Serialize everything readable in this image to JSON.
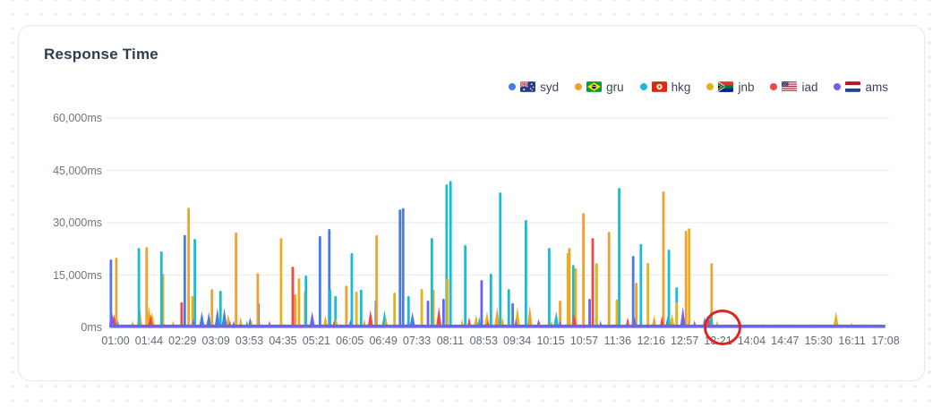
{
  "card": {
    "title": "Response Time"
  },
  "legend": {
    "items": [
      {
        "label": "syd",
        "flag": "australia",
        "color": "#4a7ae6"
      },
      {
        "label": "gru",
        "flag": "brazil",
        "color": "#f0a12f"
      },
      {
        "label": "hkg",
        "flag": "hongkong",
        "color": "#19bcd6"
      },
      {
        "label": "jnb",
        "flag": "southafrica",
        "color": "#e8b019"
      },
      {
        "label": "iad",
        "flag": "usa",
        "color": "#ef4646"
      },
      {
        "label": "ams",
        "flag": "netherlands",
        "color": "#6b64f3"
      }
    ]
  },
  "chart_data": {
    "type": "area",
    "title": "Response Time",
    "unit": "ms",
    "ylim": [
      0,
      60000
    ],
    "grid": true,
    "legend_position": "top-right",
    "y_ticks": [
      "60,000ms",
      "45,000ms",
      "30,000ms",
      "15,000ms",
      "0ms"
    ],
    "y_tick_values": [
      60000,
      45000,
      30000,
      15000,
      0
    ],
    "x_ticks": [
      "01:00",
      "01:44",
      "02:29",
      "03:09",
      "03:53",
      "04:35",
      "05:21",
      "06:05",
      "06:49",
      "07:33",
      "08:11",
      "08:53",
      "09:34",
      "10:15",
      "10:57",
      "11:36",
      "12:16",
      "12:57",
      "13:21",
      "14:04",
      "14:47",
      "15:30",
      "16:11",
      "17:08"
    ],
    "baseline_ms": 800,
    "series": [
      {
        "name": "syd",
        "flag": "australia",
        "color": "#4a7ae6",
        "spikes": [
          [
            0.001,
            19500
          ],
          [
            0.067,
            2500
          ],
          [
            0.096,
            26500
          ],
          [
            0.118,
            4600
          ],
          [
            0.127,
            4400
          ],
          [
            0.138,
            5600
          ],
          [
            0.147,
            5600
          ],
          [
            0.18,
            3000
          ],
          [
            0.191,
            6900
          ],
          [
            0.27,
            26200
          ],
          [
            0.282,
            28200
          ],
          [
            0.342,
            7700
          ],
          [
            0.373,
            33800
          ],
          [
            0.377,
            34200
          ],
          [
            0.389,
            4500
          ],
          [
            0.401,
            2200
          ],
          [
            0.518,
            7000
          ],
          [
            0.551,
            2500
          ],
          [
            0.631,
            2000
          ],
          [
            0.673,
            20500
          ],
          [
            0.718,
            4000
          ],
          [
            0.765,
            3000
          ]
        ]
      },
      {
        "name": "gru",
        "flag": "brazil",
        "color": "#f0a12f",
        "spikes": [
          [
            0.008,
            20000
          ],
          [
            0.038,
            6400
          ],
          [
            0.047,
            23000
          ],
          [
            0.068,
            15400
          ],
          [
            0.101,
            34300
          ],
          [
            0.131,
            11000
          ],
          [
            0.162,
            27200
          ],
          [
            0.19,
            15500
          ],
          [
            0.238,
            9500
          ],
          [
            0.251,
            10300
          ],
          [
            0.304,
            12000
          ],
          [
            0.327,
            2500
          ],
          [
            0.343,
            26400
          ],
          [
            0.384,
            3200
          ],
          [
            0.416,
            10800
          ],
          [
            0.471,
            3600
          ],
          [
            0.498,
            5900
          ],
          [
            0.54,
            6400
          ],
          [
            0.579,
            7700
          ],
          [
            0.591,
            22800
          ],
          [
            0.609,
            32800
          ],
          [
            0.642,
            27400
          ],
          [
            0.677,
            12800
          ],
          [
            0.7,
            3500
          ],
          [
            0.712,
            39000
          ],
          [
            0.741,
            27700
          ],
          [
            0.774,
            18400
          ],
          [
            0.839,
            1100
          ],
          [
            0.902,
            1000
          ],
          [
            0.954,
            1400
          ],
          [
            0.983,
            900
          ]
        ]
      },
      {
        "name": "hkg",
        "flag": "hongkong",
        "color": "#19bcd6",
        "spikes": [
          [
            0.01,
            2000
          ],
          [
            0.037,
            22800
          ],
          [
            0.066,
            21800
          ],
          [
            0.109,
            25400
          ],
          [
            0.142,
            10500
          ],
          [
            0.176,
            2000
          ],
          [
            0.252,
            14900
          ],
          [
            0.283,
            11000
          ],
          [
            0.29,
            9000
          ],
          [
            0.311,
            21300
          ],
          [
            0.323,
            10800
          ],
          [
            0.353,
            5000
          ],
          [
            0.384,
            9000
          ],
          [
            0.414,
            25600
          ],
          [
            0.433,
            41000
          ],
          [
            0.438,
            42000
          ],
          [
            0.457,
            23600
          ],
          [
            0.475,
            3000
          ],
          [
            0.49,
            15400
          ],
          [
            0.502,
            38700
          ],
          [
            0.513,
            11000
          ],
          [
            0.535,
            30800
          ],
          [
            0.565,
            22800
          ],
          [
            0.574,
            4600
          ],
          [
            0.596,
            17900
          ],
          [
            0.655,
            40000
          ],
          [
            0.683,
            23900
          ],
          [
            0.719,
            22300
          ],
          [
            0.729,
            11500
          ],
          [
            0.773,
            5000
          ]
        ]
      },
      {
        "name": "jnb",
        "flag": "southafrica",
        "color": "#e8b019",
        "spikes": [
          [
            0.029,
            2000
          ],
          [
            0.05,
            6200
          ],
          [
            0.054,
            4400
          ],
          [
            0.081,
            2000
          ],
          [
            0.106,
            9000
          ],
          [
            0.152,
            3800
          ],
          [
            0.168,
            3000
          ],
          [
            0.182,
            2300
          ],
          [
            0.205,
            2000
          ],
          [
            0.22,
            25600
          ],
          [
            0.243,
            14100
          ],
          [
            0.277,
            3500
          ],
          [
            0.291,
            2800
          ],
          [
            0.317,
            10300
          ],
          [
            0.355,
            3000
          ],
          [
            0.366,
            10000
          ],
          [
            0.401,
            11000
          ],
          [
            0.434,
            14000
          ],
          [
            0.453,
            2500
          ],
          [
            0.485,
            4600
          ],
          [
            0.505,
            3000
          ],
          [
            0.524,
            5900
          ],
          [
            0.568,
            2000
          ],
          [
            0.589,
            21300
          ],
          [
            0.599,
            17000
          ],
          [
            0.626,
            18400
          ],
          [
            0.652,
            8000
          ],
          [
            0.692,
            18500
          ],
          [
            0.723,
            4000
          ],
          [
            0.729,
            7200
          ],
          [
            0.745,
            28400
          ],
          [
            0.752,
            2000
          ],
          [
            0.781,
            2000
          ],
          [
            0.873,
            900
          ],
          [
            0.934,
            4600
          ],
          [
            0.965,
            1000
          ]
        ]
      },
      {
        "name": "iad",
        "flag": "usa",
        "color": "#ef4646",
        "spikes": [
          [
            0.005,
            3800
          ],
          [
            0.052,
            3800
          ],
          [
            0.092,
            7200
          ],
          [
            0.154,
            2000
          ],
          [
            0.235,
            17400
          ],
          [
            0.288,
            2000
          ],
          [
            0.335,
            5100
          ],
          [
            0.423,
            6000
          ],
          [
            0.462,
            3000
          ],
          [
            0.486,
            2000
          ],
          [
            0.552,
            2000
          ],
          [
            0.597,
            4000
          ],
          [
            0.621,
            25600
          ],
          [
            0.666,
            3000
          ],
          [
            0.71,
            3300
          ],
          [
            0.77,
            3000
          ],
          [
            0.816,
            800
          ],
          [
            0.862,
            900
          ],
          [
            0.914,
            800
          ],
          [
            0.948,
            700
          ]
        ]
      },
      {
        "name": "ams",
        "flag": "netherlands",
        "color": "#6b64f3",
        "spikes": [
          [
            0.002,
            5000
          ],
          [
            0.107,
            2500
          ],
          [
            0.159,
            2000
          ],
          [
            0.205,
            1800
          ],
          [
            0.26,
            4600
          ],
          [
            0.309,
            2200
          ],
          [
            0.409,
            7700
          ],
          [
            0.429,
            8200
          ],
          [
            0.478,
            13600
          ],
          [
            0.522,
            2500
          ],
          [
            0.579,
            2000
          ],
          [
            0.617,
            8200
          ],
          [
            0.675,
            3000
          ],
          [
            0.737,
            5900
          ],
          [
            0.752,
            2000
          ]
        ]
      }
    ],
    "annotation": {
      "shape": "circle",
      "stroke": "#df241f",
      "x_fraction": 0.785,
      "y_ms": 0,
      "near_x_tick": "13:21"
    }
  }
}
